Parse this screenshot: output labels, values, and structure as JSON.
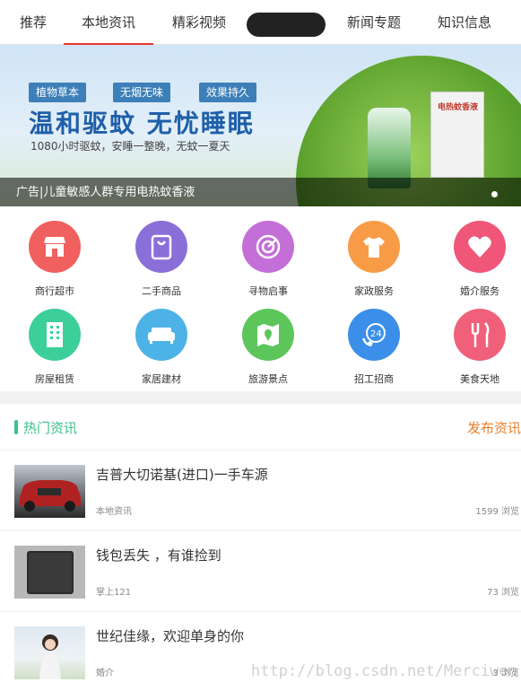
{
  "tabs": [
    "推荐",
    "本地资讯",
    "精彩视频",
    "新闻专题",
    "知识信息"
  ],
  "banner": {
    "badges": [
      "植物草本",
      "无烟无味",
      "效果持久"
    ],
    "headline": "温和驱蚊  无忧睡眠",
    "subline": "1080小时驱蚊，安睡一整晚，无蚊一夏天",
    "box_label": "电热蚊香液",
    "caption": "广告|儿童敏感人群专用电热蚊香液"
  },
  "categories": [
    {
      "label": "商行超市",
      "color": "#f0605f",
      "icon": "shop-icon"
    },
    {
      "label": "二手商品",
      "color": "#8b6fd9",
      "icon": "bag-icon"
    },
    {
      "label": "寻物启事",
      "color": "#c46ed8",
      "icon": "target-icon"
    },
    {
      "label": "家政服务",
      "color": "#f79b46",
      "icon": "shirt-icon"
    },
    {
      "label": "婚介服务",
      "color": "#f05678",
      "icon": "heart-icon"
    },
    {
      "label": "房屋租赁",
      "color": "#3ccf9a",
      "icon": "building-icon"
    },
    {
      "label": "家居建材",
      "color": "#4db3e7",
      "icon": "sofa-icon"
    },
    {
      "label": "旅游景点",
      "color": "#5cc65a",
      "icon": "map-icon"
    },
    {
      "label": "招工招商",
      "color": "#3b8fe8",
      "icon": "phone-24-icon"
    },
    {
      "label": "美食天地",
      "color": "#f0607a",
      "icon": "cutlery-icon"
    }
  ],
  "section": {
    "title": "热门资讯",
    "action": "发布资讯"
  },
  "news": [
    {
      "title": "吉普大切诺基(进口)一手车源",
      "source": "本地资讯",
      "views": "1599 浏览"
    },
    {
      "title": "钱包丢失 ，有谁捡到",
      "source": "掌上121",
      "views": "73 浏览"
    },
    {
      "title": "世纪佳缘，欢迎单身的你",
      "source": "婚介",
      "views": "3 浏览"
    }
  ],
  "watermark": "http://blog.csdn.net/Merciwen"
}
